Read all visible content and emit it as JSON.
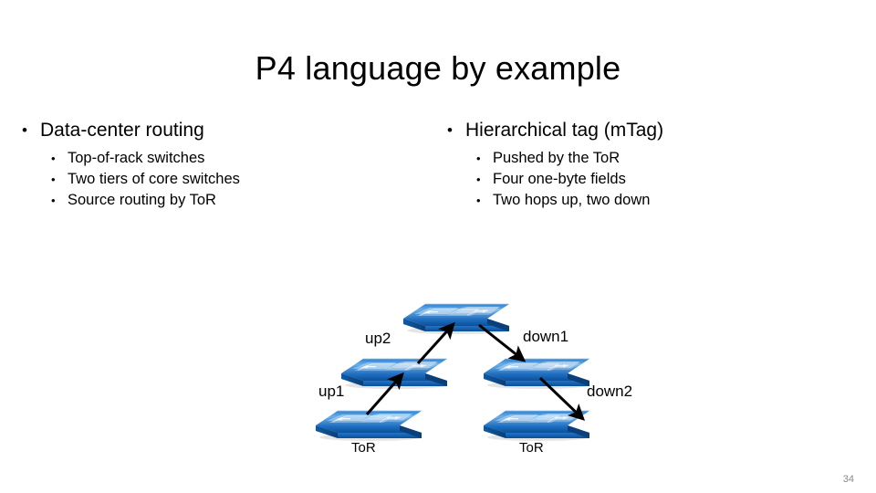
{
  "slide": {
    "title": "P4 language by example",
    "page_number": "34",
    "bullet_marker": "•"
  },
  "columns": {
    "left": {
      "heading": "Data-center routing",
      "items": [
        "Top-of-rack switches",
        "Two tiers of core switches",
        "Source routing by ToR"
      ]
    },
    "right": {
      "heading": "Hierarchical tag (mTag)",
      "items": [
        "Pushed by the ToR",
        "Four one-byte fields",
        "Two hops up, two down"
      ]
    }
  },
  "diagram": {
    "title": "mTag hierarchical data-center topology",
    "switch_color_top": "#4e9fe0",
    "switch_color_front": "#1664b4",
    "switch_color_side": "#0d4e91",
    "arrow_color": "#000000",
    "edge_labels": [
      {
        "name": "up2",
        "text": "up2"
      },
      {
        "name": "down1",
        "text": "down1"
      },
      {
        "name": "up1",
        "text": "up1"
      },
      {
        "name": "down2",
        "text": "down2"
      }
    ],
    "node_labels": [
      {
        "name": "tor-left",
        "text": "ToR"
      },
      {
        "name": "tor-right",
        "text": "ToR"
      }
    ]
  }
}
